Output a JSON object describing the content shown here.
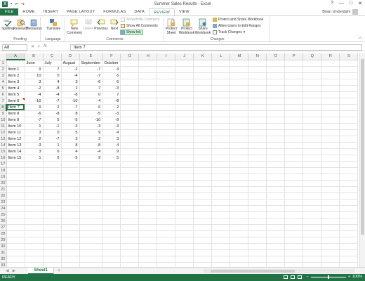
{
  "window": {
    "title": "Summer Sales Results - Excel",
    "user": "Brian Underdahl",
    "help": "?",
    "minimize": "—",
    "maximize": "□",
    "close": "✕"
  },
  "qat": {
    "undo": "↶",
    "redo": "↷"
  },
  "tabs": [
    "FILE",
    "HOME",
    "INSERT",
    "PAGE LAYOUT",
    "FORMULAS",
    "DATA",
    "REVIEW",
    "VIEW"
  ],
  "active_tab": "REVIEW",
  "ribbon": {
    "proofing": {
      "label": "Proofing",
      "spelling": "Spelling",
      "research": "Research",
      "thesaurus": "Thesaurus"
    },
    "language": {
      "label": "Language",
      "translate": "Translate"
    },
    "comments": {
      "label": "Comments",
      "new_comment": "New Comment",
      "delete": "Delete",
      "previous": "Previous",
      "next": "Next",
      "show_hide": "Show/Hide Comment",
      "show_all": "Show All Comments",
      "show_ink": "Show Ink"
    },
    "changes": {
      "label": "Changes",
      "protect_sheet": "Protect Sheet",
      "protect_workbook": "Protect Workbook",
      "share_workbook": "Share Workbook",
      "protect_share": "Protect and Share Workbook",
      "allow_users": "Allow Users to Edit Ranges",
      "track_changes": "Track Changes"
    }
  },
  "formula_bar": {
    "name_box": "A8",
    "fx": "fx",
    "cancel": "✕",
    "enter": "✓",
    "value": "Item 7"
  },
  "columns": [
    "A",
    "B",
    "C",
    "D",
    "E",
    "F",
    "G",
    "H",
    "I",
    "J",
    "K",
    "L",
    "M",
    "N",
    "O",
    "P",
    "Q",
    "R",
    "S"
  ],
  "headers": [
    "",
    "June",
    "July",
    "August",
    "September",
    "October"
  ],
  "rows": [
    [
      "Item 1",
      9,
      7,
      -2,
      -7,
      4
    ],
    [
      "Item 2",
      10,
      0,
      -4,
      -7,
      6
    ],
    [
      "Item 3",
      3,
      4,
      3,
      -6,
      6
    ],
    [
      "Item 4",
      -2,
      -8,
      2,
      7,
      -3
    ],
    [
      "Item 5",
      -4,
      -4,
      -8,
      0,
      7
    ],
    [
      "Item 6",
      -10,
      -7,
      -10,
      4,
      -8
    ],
    [
      "Item 7",
      9,
      2,
      -7,
      6,
      2
    ],
    [
      "Item 8",
      -6,
      -8,
      8,
      -5,
      -3
    ],
    [
      "Item 9",
      -7,
      5,
      -5,
      -10,
      -9
    ],
    [
      "Item 10",
      1,
      -1,
      -3,
      -3,
      -3
    ],
    [
      "Item 11",
      3,
      0,
      5,
      9,
      4
    ],
    [
      "Item 12",
      2,
      -7,
      3,
      2,
      3
    ],
    [
      "Item 13",
      -3,
      1,
      8,
      -8,
      4
    ],
    [
      "Item 14",
      3,
      6,
      4,
      -4,
      9
    ],
    [
      "Item 15",
      1,
      6,
      -5,
      9,
      5
    ]
  ],
  "total_rows": 35,
  "selected_cell": {
    "row": 8,
    "col": "A"
  },
  "comment_cell": {
    "row": 7,
    "col": "A"
  },
  "sheet": {
    "name": "Sheet1",
    "add": "+"
  },
  "status": {
    "ready": "READY",
    "zoom": "100%",
    "minus": "−",
    "plus": "+"
  },
  "colors": {
    "accent": "#217346",
    "comment": "#c00000"
  }
}
